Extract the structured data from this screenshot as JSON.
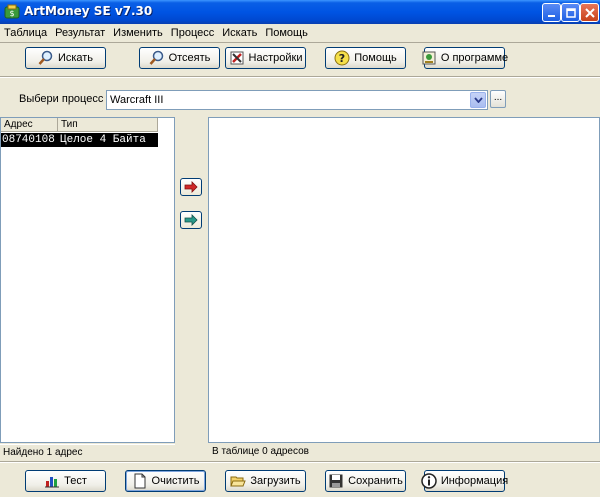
{
  "window": {
    "title": "ArtMoney SE v7.30"
  },
  "menu": [
    "Таблица",
    "Результат",
    "Изменить",
    "Процесс",
    "Искать",
    "Помощь"
  ],
  "toolbar": {
    "search": "Искать",
    "filter": "Отсеять",
    "settings": "Настройки",
    "help": "Помощь",
    "about": "О программе"
  },
  "process": {
    "label": "Выбери процесс",
    "selected": "Warcraft III",
    "browse": "..."
  },
  "results": {
    "columns": [
      "Адрес",
      "Тип"
    ],
    "rows": [
      {
        "address": "08740108",
        "type": "Целое 4 Байта"
      }
    ],
    "status": "Найдено 1 адрес"
  },
  "table": {
    "status": "В таблице 0 адресов"
  },
  "bottom": {
    "test": "Тест",
    "clear": "Очистить",
    "load": "Загрузить",
    "save": "Сохранить",
    "info": "Информация"
  },
  "colors": {
    "titlebar": "#0054e3",
    "selection": "#000000",
    "annotation": "#3fb8f0"
  }
}
